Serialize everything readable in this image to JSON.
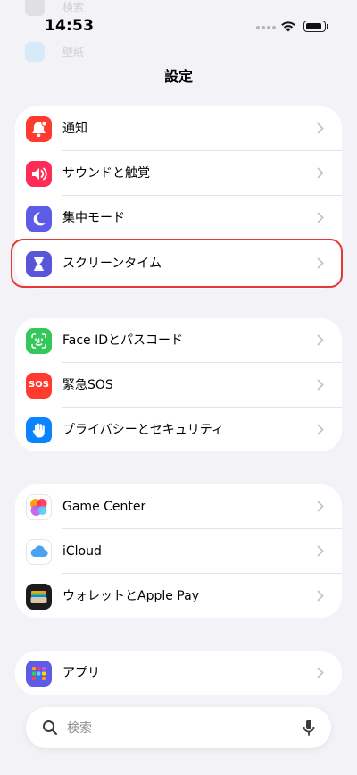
{
  "status_bar": {
    "time": "14:53"
  },
  "ghost_rows": [
    "検索",
    "壁紙"
  ],
  "page_title": "設定",
  "groups": [
    {
      "items": [
        {
          "label": "通知",
          "icon": "bell-icon",
          "color": "#ff3b30"
        },
        {
          "label": "サウンドと触覚",
          "icon": "speaker-icon",
          "color": "#ff2d55"
        },
        {
          "label": "集中モード",
          "icon": "moon-icon",
          "color": "#5e5ce6"
        },
        {
          "label": "スクリーンタイム",
          "icon": "hourglass-icon",
          "color": "#5856d6",
          "highlighted": true
        }
      ]
    },
    {
      "items": [
        {
          "label": "Face IDとパスコード",
          "icon": "faceid-icon",
          "color": "#34c759"
        },
        {
          "label": "緊急SOS",
          "icon": "sos-icon",
          "color": "#ff3b30",
          "icon_text": "SOS"
        },
        {
          "label": "プライバシーとセキュリティ",
          "icon": "hand-icon",
          "color": "#0a84ff"
        }
      ]
    },
    {
      "items": [
        {
          "label": "Game Center",
          "icon": "game-center-icon",
          "color": "#ffffff"
        },
        {
          "label": "iCloud",
          "icon": "cloud-icon",
          "color": "#ffffff"
        },
        {
          "label": "ウォレットとApple Pay",
          "icon": "wallet-icon",
          "color": "#1c1c1e"
        }
      ]
    },
    {
      "items": [
        {
          "label": "アプリ",
          "icon": "apps-grid-icon",
          "color": "#5e5ce6"
        }
      ]
    }
  ],
  "search": {
    "placeholder": "検索"
  }
}
